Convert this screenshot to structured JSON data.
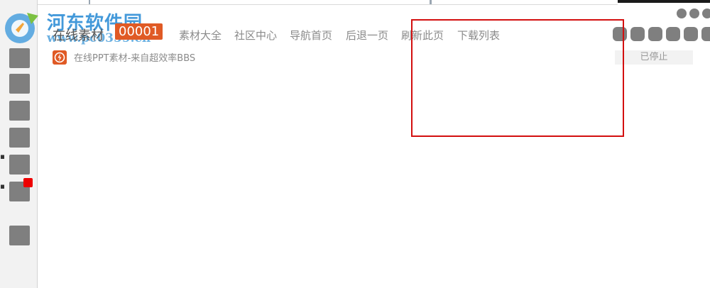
{
  "watermark": {
    "site_name": "河东软件园",
    "site_url": "www.pc0359.cn"
  },
  "header": {
    "brand_label": "在线素材",
    "brand_badge": "00001",
    "nav": [
      "素材大全",
      "社区中心",
      "导航首页",
      "后退一页",
      "刷新此页",
      "下载列表"
    ]
  },
  "downloads": [
    {
      "title": "在线PPT素材-来自超效率BBS",
      "status": "已停止"
    }
  ],
  "colors": {
    "accent": "#e05a25",
    "highlight_box": "#d30f0f",
    "icon_gray": "#7f7f7f",
    "badge_red": "#ee0000"
  },
  "icons": {
    "sidebar": [
      "app-icon",
      "app-icon",
      "app-icon",
      "app-icon",
      "app-icon",
      "app-icon",
      "app-icon"
    ],
    "row": "lightning-icon"
  }
}
